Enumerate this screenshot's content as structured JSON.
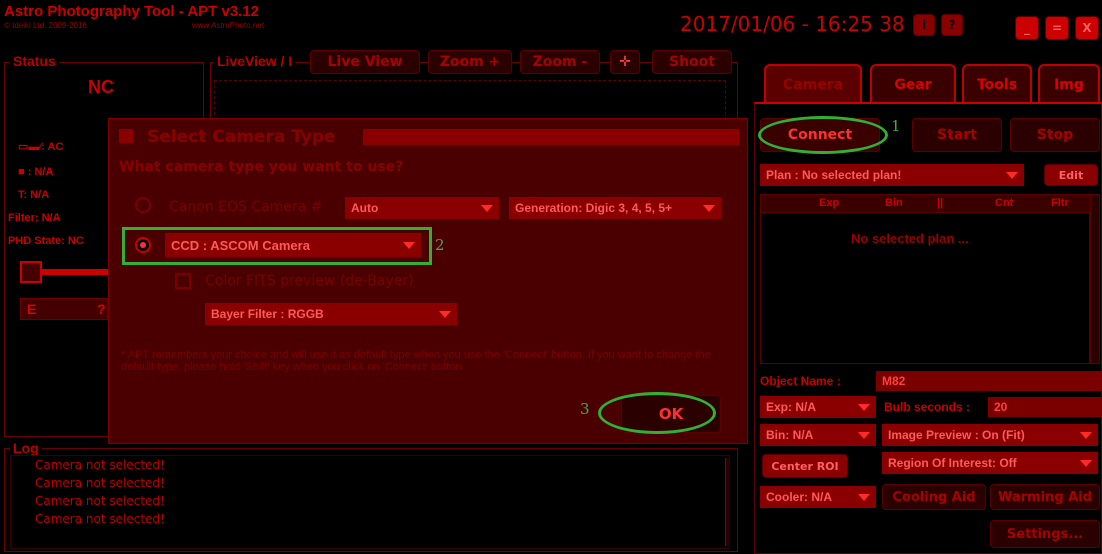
{
  "titlebar": {
    "app_title": "Astro Photography Tool - APT v3.12",
    "copyright": "© Ideiki Ltd. 2009-2016",
    "website": "www.AstroPhoto.net",
    "datetime": "2017/01/06 - 16:25 38",
    "btn_info": "i",
    "btn_help": "?",
    "btn_min": "_",
    "btn_max": "=",
    "btn_close": "X"
  },
  "status": {
    "title": "Status",
    "connection": "NC",
    "power": ": AC",
    "camera": ": N/A",
    "temp": "T: N/A",
    "filter": "Filter: N/A",
    "phd": "PHD State: NC",
    "e_label": "E",
    "q_label": "?"
  },
  "liveview": {
    "title": "LiveView / I",
    "live_view": "Live View",
    "zoom_in": "Zoom +",
    "zoom_out": "Zoom -",
    "shoot": "Shoot"
  },
  "dialog": {
    "title": "Select Camera Type",
    "question": "What camera type you want to use?",
    "canon_label": "Canon EOS Camera #",
    "canon_model": "Auto",
    "generation": "Generation: Digic 3, 4, 5, 5+",
    "ccd_option": "CCD : ASCOM Camera",
    "color_fits": "Color FITS preview (de-Bayer)",
    "bayer_filter": "Bayer Filter : RGGB",
    "note": "* APT remembers your choice and will use it as default type when you use the 'Connect' button. If you want to change the default type, please hold 'Shift' key when you click on 'Connect' button.",
    "ok": "OK"
  },
  "annotations": {
    "n1": "1",
    "n2": "2",
    "n3": "3"
  },
  "log": {
    "title": "Log",
    "lines": [
      "Camera not selected!",
      "Camera not selected!",
      "Camera not selected!",
      "Camera not selected!"
    ]
  },
  "tabs": [
    "Camera",
    "Gear",
    "Tools",
    "Img"
  ],
  "camera_panel": {
    "connect": "Connect",
    "start": "Start",
    "stop": "Stop",
    "plan": "Plan : No selected plan!",
    "edit": "Edit",
    "columns": [
      "Exp",
      "Bin",
      "||",
      "Cnt",
      "Fltr"
    ],
    "empty_plan": "No selected plan ...",
    "object_label": "Object Name :",
    "object_value": "M82",
    "exp": "Exp: N/A",
    "bulb_label": "Bulb seconds :",
    "bulb_value": "20",
    "bin": "Bin: N/A",
    "image_preview": "Image Preview : On (Fit)",
    "center_roi": "Center ROI",
    "roi": "Region Of Interest: Off",
    "cooler": "Cooler: N/A",
    "cooling_aid": "Cooling Aid",
    "warming_aid": "Warming Aid",
    "settings": "Settings..."
  },
  "colors": {
    "background": "#000000",
    "accent": "#cc0000",
    "annotation": "#33b033"
  }
}
